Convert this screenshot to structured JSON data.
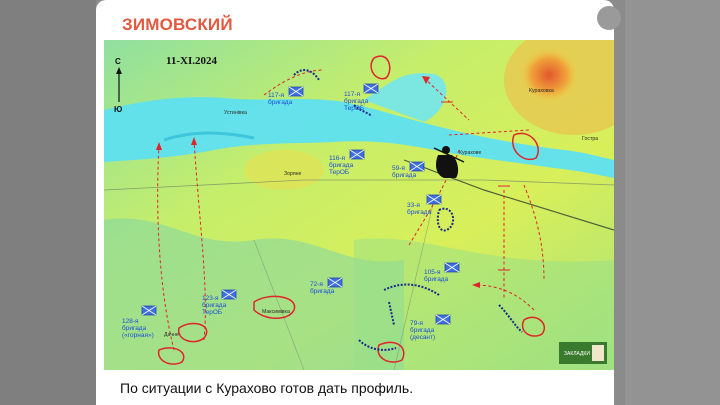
{
  "channel": {
    "name": "ЗИМОВСКИЙ"
  },
  "map": {
    "date": "11-XI.2024",
    "compass": {
      "north": "С",
      "south": "Ю"
    },
    "places": [
      "Кураховка",
      "Курахове",
      "Гостра",
      "Устинівка",
      "Дачне",
      "Зоряне",
      "Максимівка"
    ],
    "units": [
      {
        "id": "u117a",
        "lines": [
          "117-я",
          "бригада"
        ]
      },
      {
        "id": "u117b",
        "lines": [
          "117-я",
          "бригада",
          "ТерОБ"
        ]
      },
      {
        "id": "u116",
        "lines": [
          "116-я",
          "бригада",
          "ТерОБ"
        ]
      },
      {
        "id": "u59",
        "lines": [
          "59-я",
          "бригада"
        ]
      },
      {
        "id": "u33",
        "lines": [
          "33-я",
          "бригада"
        ]
      },
      {
        "id": "u105",
        "lines": [
          "105-я",
          "бригада"
        ]
      },
      {
        "id": "u123",
        "lines": [
          "123-я",
          "бригада",
          "ТерОБ"
        ]
      },
      {
        "id": "u72",
        "lines": [
          "72-я",
          "бригада"
        ]
      },
      {
        "id": "u128",
        "lines": [
          "128-я",
          "бригада",
          "(«горная»)"
        ]
      },
      {
        "id": "u79",
        "lines": [
          "79-я",
          "бригада",
          "(десант)"
        ]
      }
    ],
    "logo_text": "ЗАКЛАДКИ",
    "colors": {
      "river": "#5fe0f0",
      "friendly_unit": "#3d6fe0",
      "arrows": "#e0242a",
      "frontline": "#1b2a8a"
    }
  },
  "caption": "По ситуации с Курахово готов дать профиль."
}
